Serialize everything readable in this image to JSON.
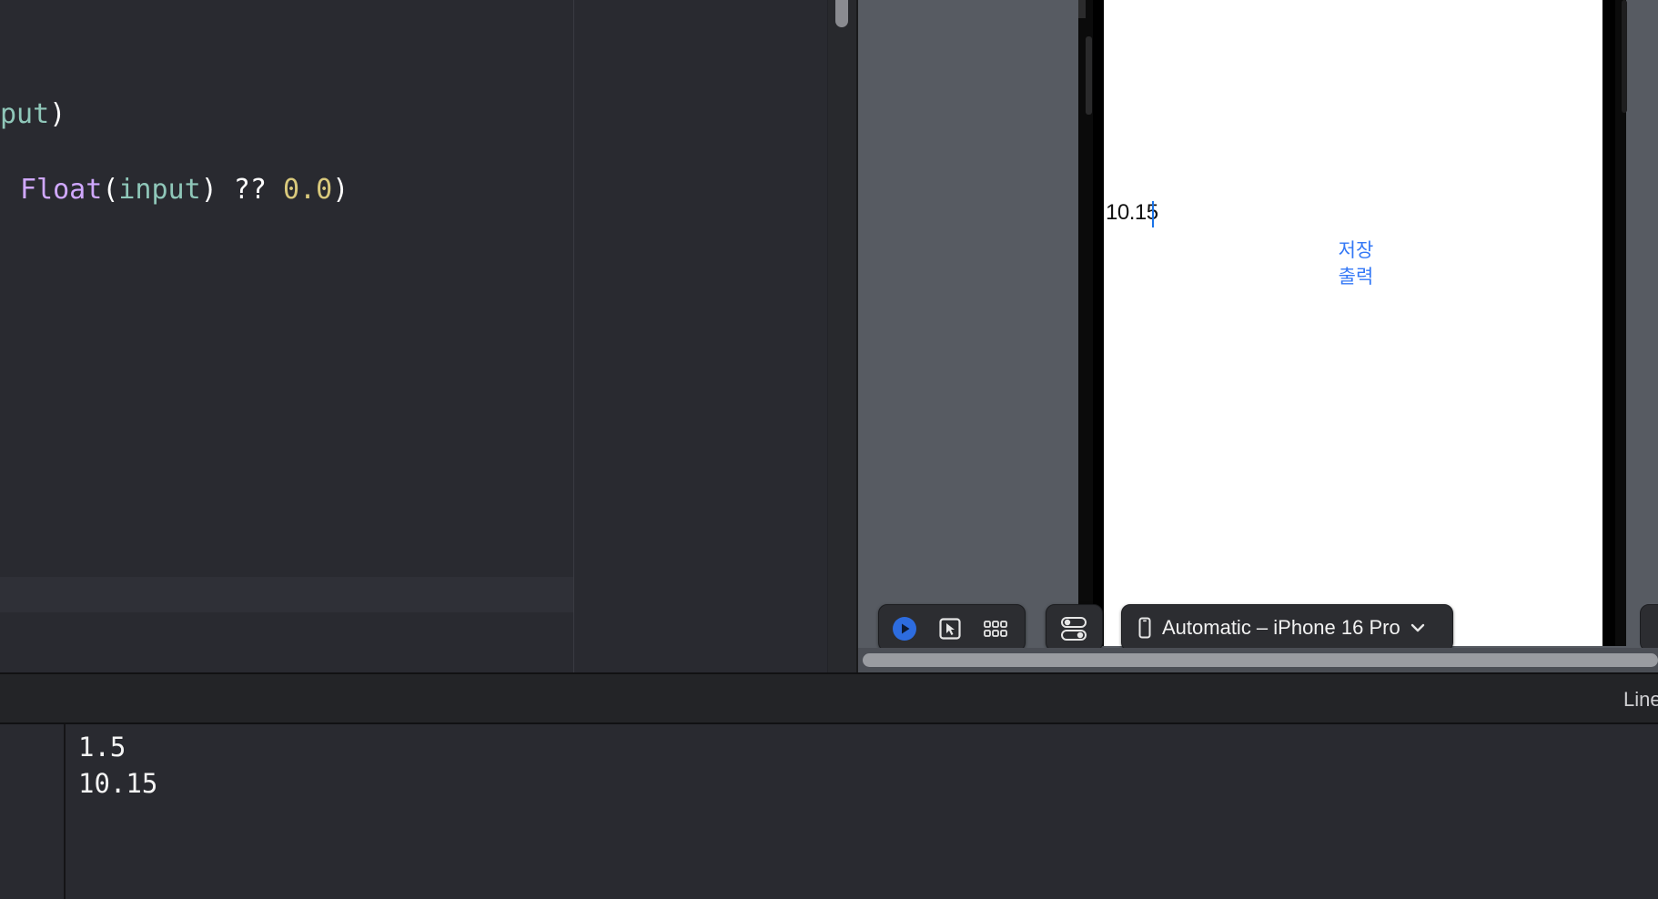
{
  "editor": {
    "line1": {
      "var_tail": "put",
      "close": ")"
    },
    "line2": {
      "type": "Float",
      "open": "(",
      "var": "input",
      "mid": ") ?? ",
      "num": "0.0",
      "close": ")"
    }
  },
  "preview": {
    "textfield_value": "10.15",
    "save_button_label": "저장",
    "print_button_label": "출력"
  },
  "canvas_toolbar": {
    "live_icon": "play-icon",
    "select_icon": "cursor-select-icon",
    "variants_icon": "grid-icon",
    "settings_icon": "toggles-icon",
    "device_icon": "iphone-icon",
    "device_label": "Automatic – iPhone 16 Pro",
    "chevron_icon": "chevron-down-icon"
  },
  "debug_bar": {
    "right_label": "Line"
  },
  "console": {
    "lines": [
      "1.5",
      "10.15"
    ]
  },
  "colors": {
    "accent_blue": "#3478f6",
    "live_blue": "#2d6cdf",
    "editor_bg": "#292a30"
  }
}
